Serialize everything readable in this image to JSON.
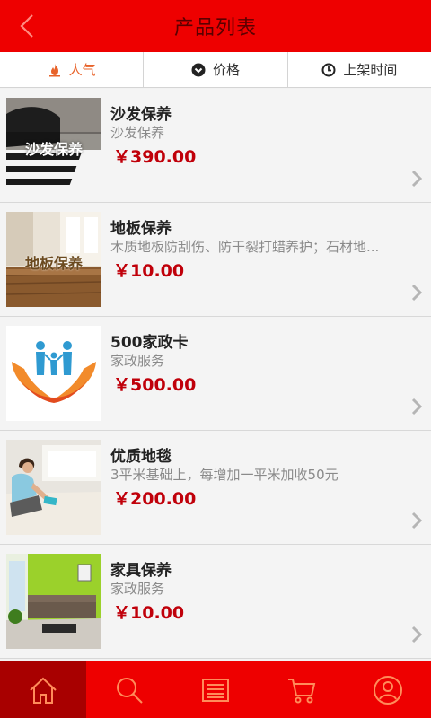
{
  "header": {
    "title": "产品列表",
    "back_icon": "chevron-left-icon"
  },
  "sort_tabs": [
    {
      "label": "人气",
      "icon": "flame-icon",
      "active": true
    },
    {
      "label": "价格",
      "icon": "chevron-down-circle-icon",
      "active": false
    },
    {
      "label": "上架时间",
      "icon": "clock-icon",
      "active": false
    }
  ],
  "products": [
    {
      "title": "沙发保养",
      "desc": "沙发保养",
      "price": "￥390.00",
      "image_text": "沙发保养"
    },
    {
      "title": "地板保养",
      "desc": "木质地板防刮伤、防干裂打蜡养护；石材地...",
      "price": "￥10.00",
      "image_text": "地板保养"
    },
    {
      "title": "500家政卡",
      "desc": "家政服务",
      "price": "￥500.00",
      "image_text": ""
    },
    {
      "title": "优质地毯",
      "desc": "3平米基础上，每增加一平米加收50元",
      "price": "￥200.00",
      "image_text": ""
    },
    {
      "title": "家具保养",
      "desc": "家政服务",
      "price": "￥10.00",
      "image_text": ""
    }
  ],
  "bottom_nav": [
    {
      "name": "home",
      "icon": "home-icon",
      "active": true
    },
    {
      "name": "search",
      "icon": "search-icon",
      "active": false
    },
    {
      "name": "list",
      "icon": "list-icon",
      "active": false
    },
    {
      "name": "cart",
      "icon": "cart-icon",
      "active": false
    },
    {
      "name": "user",
      "icon": "user-icon",
      "active": false
    }
  ],
  "colors": {
    "brand_red": "#ee0000",
    "nav_active": "#a80000",
    "price_red": "#c0000a",
    "active_tab": "#e8632a"
  }
}
